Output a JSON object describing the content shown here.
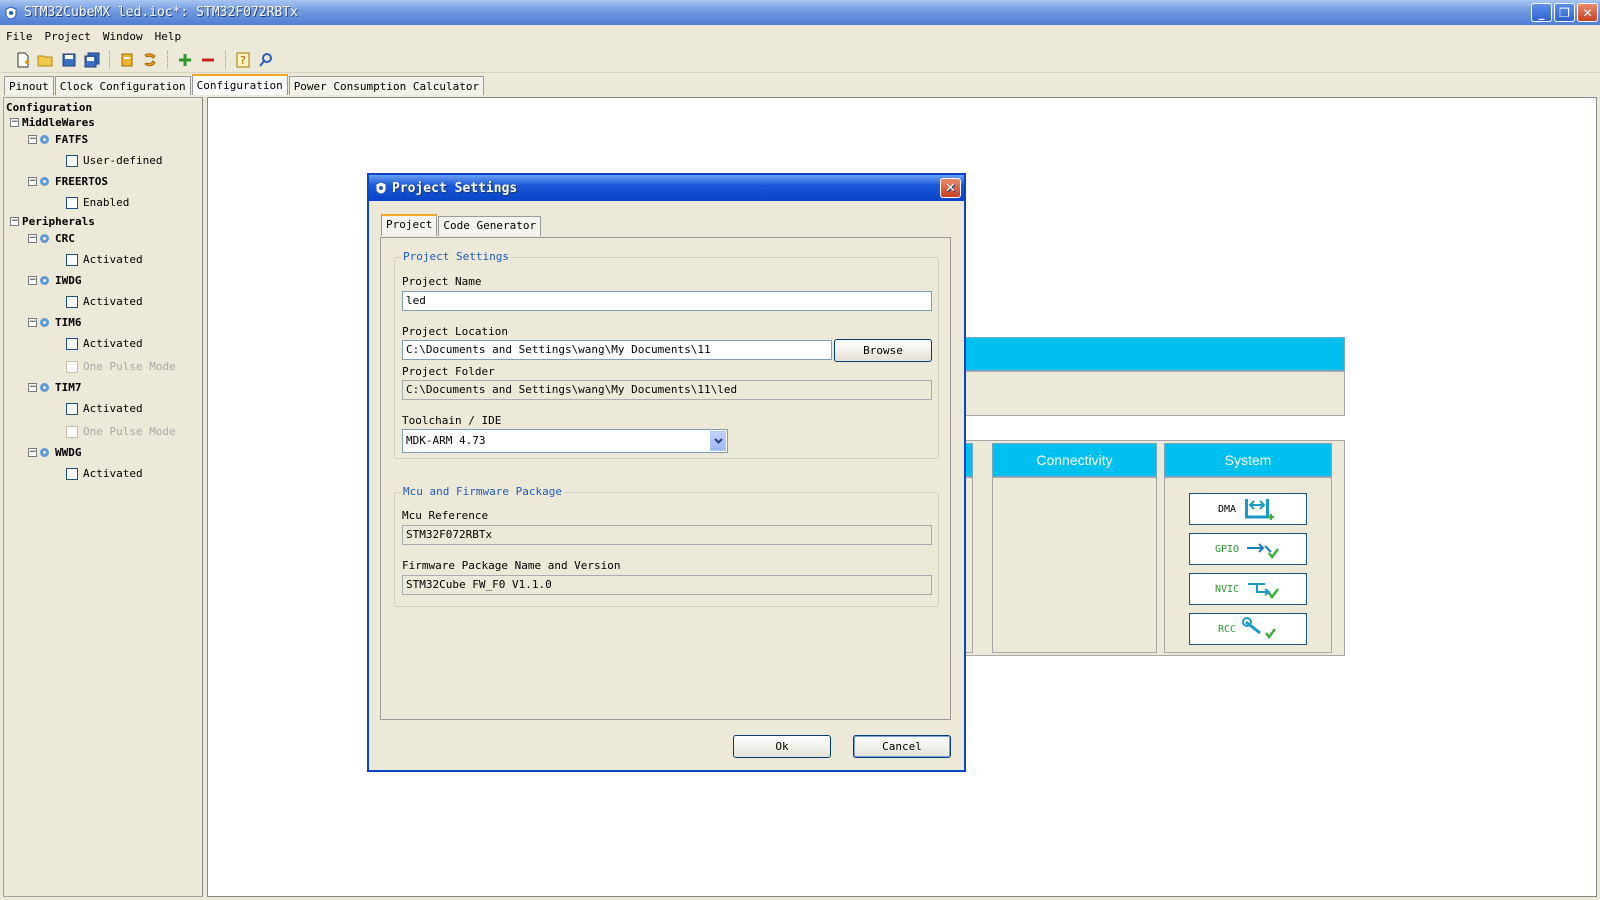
{
  "window": {
    "title": "STM32CubeMX led.ioc*: STM32F072RBTx"
  },
  "menu": [
    "File",
    "Project",
    "Window",
    "Help"
  ],
  "main_tabs": [
    "Pinout",
    "Clock Configuration",
    "Configuration",
    "Power Consumption Calculator"
  ],
  "tree": {
    "root": "Configuration",
    "middlewares": "MiddleWares",
    "fatfs": "FATFS",
    "fatfs_opt": "User-defined",
    "freertos": "FREERTOS",
    "freertos_opt": "Enabled",
    "peripherals": "Peripherals",
    "crc": "CRC",
    "crc_opt": "Activated",
    "iwdg": "IWDG",
    "iwdg_opt": "Activated",
    "tim6": "TIM6",
    "tim6_opt": "Activated",
    "tim6_opt2": "One Pulse Mode",
    "tim7": "TIM7",
    "tim7_opt": "Activated",
    "tim7_opt2": "One Pulse Mode",
    "wwdg": "WWDG",
    "wwdg_opt": "Activated"
  },
  "workspace": {
    "connectivity": "Connectivity",
    "system": "System",
    "sys_buttons": [
      "DMA",
      "GPIO",
      "NVIC",
      "RCC"
    ]
  },
  "dialog": {
    "title": "Project Settings",
    "tabs": [
      "Project",
      "Code Generator"
    ],
    "project_group": "Project Settings",
    "project_name_label": "Project Name",
    "project_name": "led",
    "project_location_label": "Project Location",
    "project_location": "C:\\Documents and Settings\\wang\\My Documents\\11",
    "browse": "Browse",
    "project_folder_label": "Project Folder",
    "project_folder": "C:\\Documents and Settings\\wang\\My Documents\\11\\led",
    "toolchain_label": "Toolchain / IDE",
    "toolchain": "MDK-ARM 4.73",
    "mcu_group": "Mcu and Firmware Package",
    "mcu_ref_label": "Mcu Reference",
    "mcu_ref": "STM32F072RBTx",
    "fw_label": "Firmware Package Name and Version",
    "fw": "STM32Cube FW_F0 V1.1.0",
    "ok": "Ok",
    "cancel": "Cancel"
  }
}
